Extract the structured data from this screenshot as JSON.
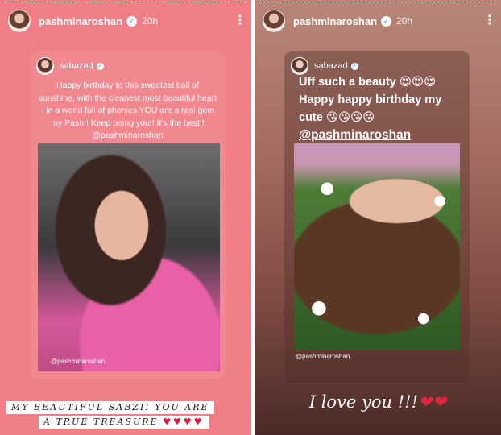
{
  "left_story": {
    "username": "pashminaroshan",
    "time": "20h",
    "more_icon": "⋮",
    "card": {
      "username": "sabazad",
      "text": "Happy birthday to this sweetest ball of sunshine, with the cleanest most beautiful heart - in a world full of phonies YOU are a real gem my Pash!! Keep being you!! It's the best!! @pashminaroshan",
      "photo_credit": "@pashminaroshan"
    },
    "caption_line1": "MY BEAUTIFUL SABZI! YOU ARE",
    "caption_line2": "A TRUE TREASURE",
    "caption_hearts": "♥♥♥♥",
    "background_color": "#f07e87"
  },
  "right_story": {
    "username": "pashminaroshan",
    "time": "20h",
    "more_icon": "⋮",
    "card": {
      "username": "sabazad",
      "line1": "Uff such a beauty 😍😍😍",
      "line2": "Happy happy birthday my cute 😘😘😘😘",
      "mention": "@pashminaroshan",
      "photo_credit": "@pashminaroshan"
    },
    "caption": "I love you !!!",
    "caption_hearts": "❤❤"
  },
  "icons": {
    "verified": "verified-badge-icon",
    "more": "more-options-icon"
  }
}
